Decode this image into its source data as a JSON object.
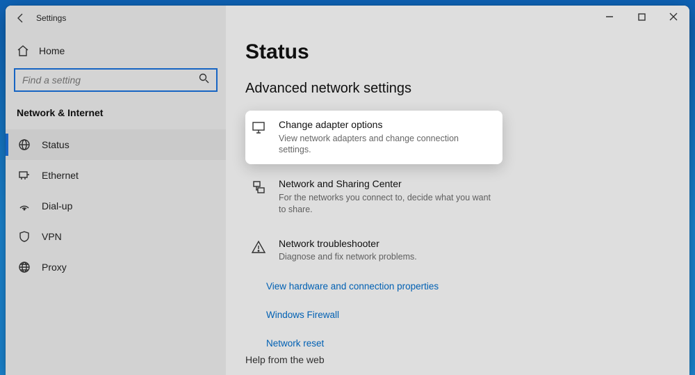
{
  "titlebar": {
    "app_title": "Settings"
  },
  "sidebar": {
    "home_label": "Home",
    "search_placeholder": "Find a setting",
    "group_title": "Network & Internet",
    "items": [
      {
        "label": "Status"
      },
      {
        "label": "Ethernet"
      },
      {
        "label": "Dial-up"
      },
      {
        "label": "VPN"
      },
      {
        "label": "Proxy"
      }
    ]
  },
  "main": {
    "page_title": "Status",
    "section_title": "Advanced network settings",
    "options": [
      {
        "title": "Change adapter options",
        "subtitle": "View network adapters and change connection settings."
      },
      {
        "title": "Network and Sharing Center",
        "subtitle": "For the networks you connect to, decide what you want to share."
      },
      {
        "title": "Network troubleshooter",
        "subtitle": "Diagnose and fix network problems."
      }
    ],
    "links": [
      "View hardware and connection properties",
      "Windows Firewall",
      "Network reset"
    ],
    "help_title": "Help from the web"
  }
}
